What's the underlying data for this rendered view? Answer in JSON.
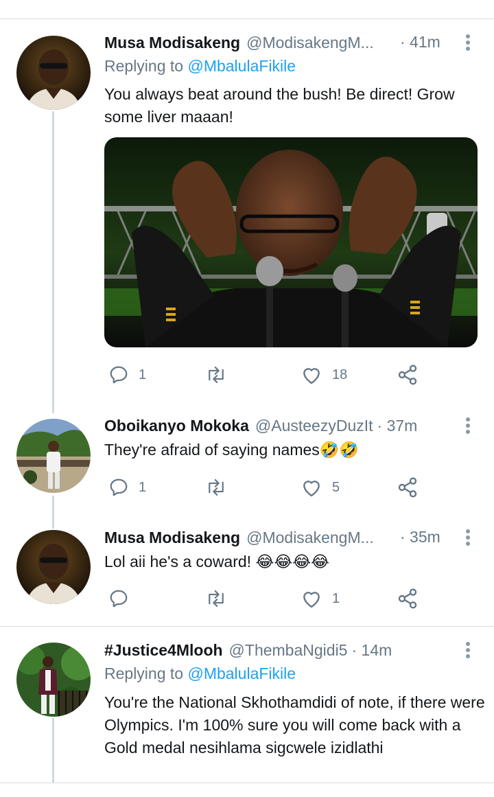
{
  "tweets": [
    {
      "name": "Musa Modisakeng",
      "handle": "@ModisakengM...",
      "time": "· 41m",
      "replying_prefix": "Replying to",
      "replying_mention": "@MbalulaFikile",
      "text": "You always beat around the bush! Be direct! Grow some liver maaan!",
      "reply_count": "1",
      "retweet_count": "",
      "like_count": "18"
    },
    {
      "name": "Oboikanyo Mokoka",
      "handle": "@AusteezyDuzIt",
      "time": "· 37m",
      "text": "They're afraid of saying names🤣🤣",
      "reply_count": "1",
      "retweet_count": "",
      "like_count": "5"
    },
    {
      "name": "Musa Modisakeng",
      "handle": "@ModisakengM...",
      "time": "· 35m",
      "text": "Lol aii he's a coward! 😂😂😂😂",
      "reply_count": "",
      "retweet_count": "",
      "like_count": "1"
    },
    {
      "name": "#Justice4Mlooh",
      "handle": "@ThembaNgidi5",
      "time": "· 14m",
      "replying_prefix": "Replying to",
      "replying_mention": "@MbalulaFikile",
      "text": "You're the National Skhothamdidi of note, if there were Olympics. I'm 100% sure you will come back with a Gold medal nesihlama sigcwele izidlathi"
    }
  ],
  "icons": {
    "reply": "reply-icon",
    "retweet": "retweet-icon",
    "like": "heart-icon",
    "share": "share-icon",
    "more": "more-vertical-icon"
  },
  "colors": {
    "accent": "#1da1f2",
    "secondary_text": "#657786",
    "thread_line": "#cfd9de"
  }
}
